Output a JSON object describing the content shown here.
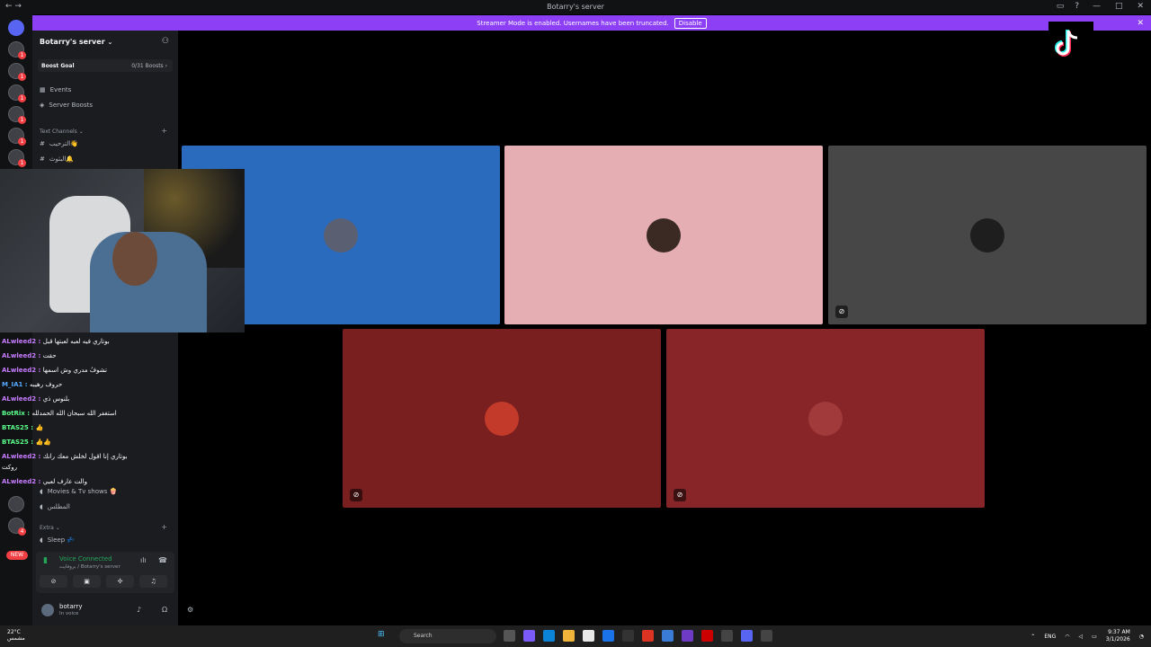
{
  "window": {
    "title": "Botarry's server",
    "nav": "← →"
  },
  "streamer_banner": {
    "text": "Streamer Mode is enabled. Usernames have been truncated.",
    "button": "Disable"
  },
  "server": {
    "name": "Botarry's server",
    "boost_goal": {
      "label": "Boost Goal",
      "progress": "0/31 Boosts",
      "progress_fraction": 0
    },
    "items": [
      {
        "label": "Events",
        "icon": "calendar-icon"
      },
      {
        "label": "Server Boosts",
        "icon": "boost-icon"
      }
    ],
    "categories": [
      {
        "label": "Text Channels",
        "channels": [
          "الترحيب👋",
          "البثوث🔔"
        ]
      },
      {
        "label": "Extra",
        "channels": [
          "Sleep 💤"
        ]
      }
    ],
    "voice_channels": [
      "Movies & Tv shows 🍿",
      "المطلس"
    ]
  },
  "voice": {
    "status": "Voice Connected",
    "channel": "بروفايت / Botarry's server",
    "buttons": [
      "video-off-icon",
      "screenshare-icon",
      "activity-icon",
      "soundboard-icon"
    ]
  },
  "user": {
    "name": "botarry",
    "status": "In voice"
  },
  "new_badge": "NEW",
  "tiles": [
    {
      "color": "#2a6bbd",
      "avatar": "#5b5f72"
    },
    {
      "color": "#e5aeb3",
      "avatar": "#3b2a24"
    },
    {
      "color": "#474747",
      "avatar": "#1e1e1e"
    },
    {
      "color": "#7a1f1f",
      "avatar": "#c43a2a"
    },
    {
      "color": "#872528",
      "avatar": "#a13a3a"
    }
  ],
  "chat": [
    {
      "user": "ALwleed2",
      "color": "#c77dff",
      "msg": "بوتاري فيه لعبه لعبتها قبل"
    },
    {
      "user": "ALwleed2",
      "color": "#c77dff",
      "msg": "حقت"
    },
    {
      "user": "ALwleed2",
      "color": "#c77dff",
      "msg": "تشوفُ مدري وش اسمها"
    },
    {
      "user": "M_IA1",
      "color": "#5aa9ff",
      "msg": "حروف رهيبه"
    },
    {
      "user": "ALwleed2",
      "color": "#c77dff",
      "msg": "بلنوس ذي"
    },
    {
      "user": "BotRix",
      "color": "#5aff8a",
      "msg": "استغفر الله سبحان الله الحمدلله"
    },
    {
      "user": "BTAS25",
      "color": "#5aff8a",
      "msg": "👍"
    },
    {
      "user": "BTAS25",
      "color": "#5aff8a",
      "msg": "👍👍"
    },
    {
      "user": "ALwleed2",
      "color": "#c77dff",
      "msg": "بوتاري إنا اقول لخلش معك رانك"
    },
    {
      "user": "",
      "color": "#ffffff",
      "msg": "روكت"
    },
    {
      "user": "ALwleed2",
      "color": "#c77dff",
      "msg": "والت عارف لعبي"
    }
  ],
  "taskbar": {
    "weather_temp": "22°C",
    "weather_desc": "مشمس",
    "search_placeholder": "Search",
    "lang": "ENG",
    "time": "9:37 AM",
    "date": "3/1/2026"
  }
}
